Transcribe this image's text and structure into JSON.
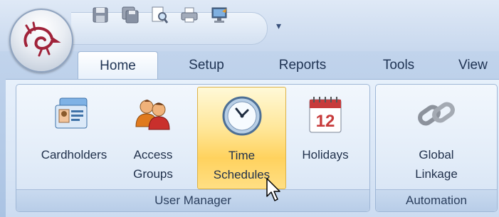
{
  "tabs": [
    {
      "label": "Home",
      "active": true
    },
    {
      "label": "Setup"
    },
    {
      "label": "Reports"
    },
    {
      "label": "Tools"
    },
    {
      "label": "View"
    }
  ],
  "quick_access": [
    {
      "icon": "save-icon"
    },
    {
      "icon": "save-all-icon"
    },
    {
      "icon": "print-preview-icon"
    },
    {
      "icon": "print-icon"
    },
    {
      "icon": "computer-icon"
    }
  ],
  "ribbon": {
    "user_manager": {
      "label": "User Manager",
      "buttons": [
        {
          "icon": "cardholders-icon",
          "line1": "Cardholders",
          "line2": ""
        },
        {
          "icon": "access-groups-icon",
          "line1": "Access",
          "line2": "Groups"
        },
        {
          "icon": "clock-icon",
          "line1": "Time",
          "line2": "Schedules",
          "highlighted": true
        },
        {
          "icon": "calendar-icon",
          "line1": "Holidays",
          "line2": "",
          "calendar_day": "12"
        }
      ]
    },
    "automation": {
      "label": "Automation",
      "buttons": [
        {
          "icon": "chain-link-icon",
          "line1": "Global",
          "line2": "Linkage"
        }
      ]
    }
  },
  "colors": {
    "ribbon_blue": "#c8d8ee",
    "highlight": "#ffd25e",
    "logo_red": "#a0233a"
  }
}
